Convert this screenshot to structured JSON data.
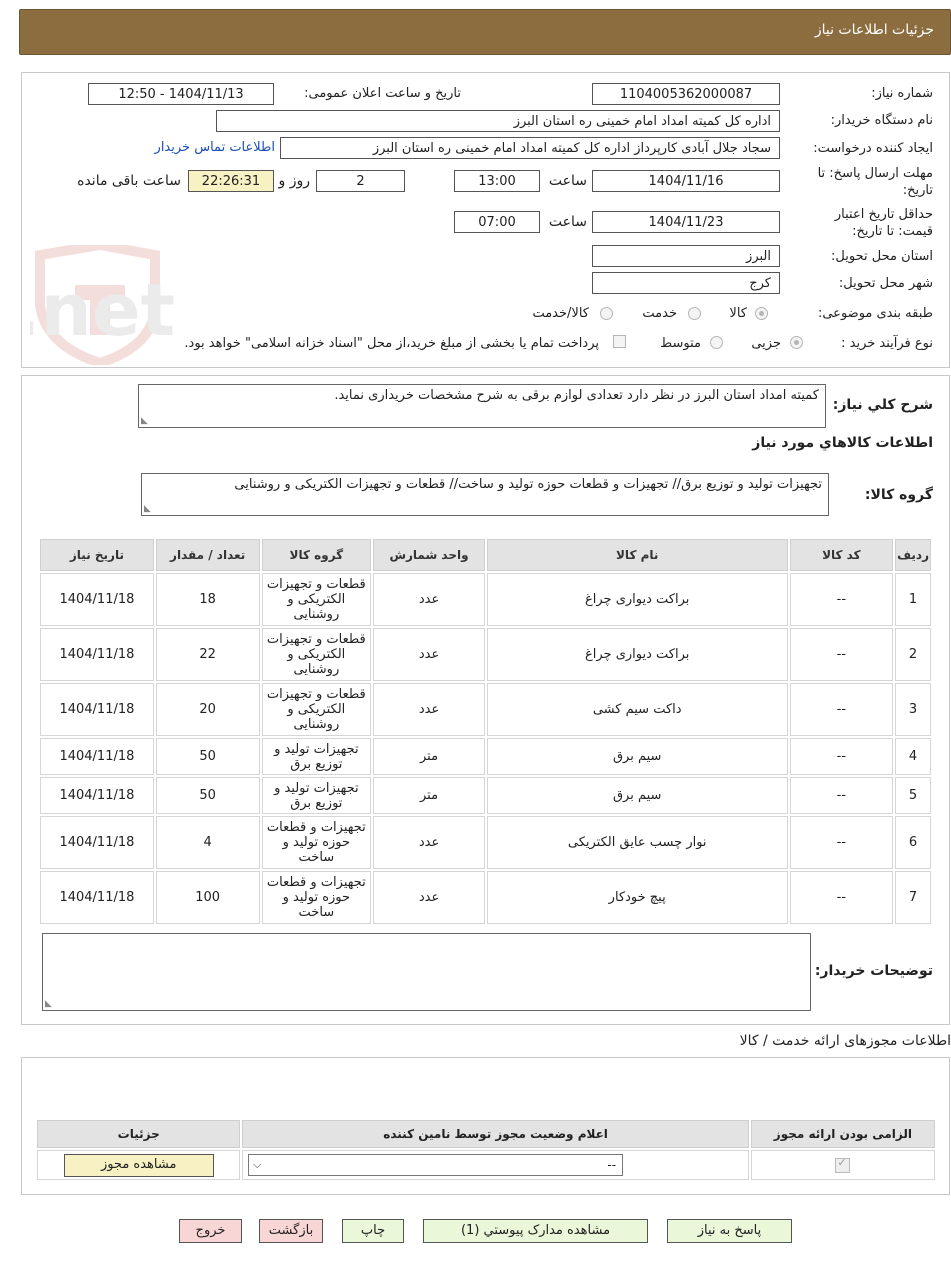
{
  "header": {
    "title": "جزئیات اطلاعات نیاز"
  },
  "info": {
    "need_number_label": "شماره نیاز:",
    "need_number": "1104005362000087",
    "announce_label": "تاریخ و ساعت اعلان عمومی:",
    "announce_value": "1404/11/13 - 12:50",
    "buyer_org_label": "نام دستگاه خریدار:",
    "buyer_org": "اداره کل کمیته امداد امام خمینی  ره  استان البرز",
    "requester_label": "ایجاد کننده درخواست:",
    "requester": "سجاد جلال آبادی کارپرداز اداره کل کمیته امداد امام خمینی  ره  استان البرز",
    "contact_link": "اطلاعات تماس خریدار",
    "deadline_label_1": "مهلت ارسال پاسخ: تا",
    "deadline_label_2": "تاریخ:",
    "deadline_date": "1404/11/16",
    "time_label": "ساعت",
    "deadline_time": "13:00",
    "days_value": "2",
    "days_label": "روز و",
    "remaining_time": "22:26:31",
    "remaining_label": "ساعت باقی مانده",
    "validity_label_1": "حداقل تاریخ اعتبار",
    "validity_label_2": "قیمت: تا تاریخ:",
    "validity_date": "1404/11/23",
    "validity_time": "07:00",
    "province_label": "استان محل تحویل:",
    "province": "البرز",
    "city_label": "شهر محل تحویل:",
    "city": "کرج",
    "category_label": "طبقه بندی موضوعی:",
    "category_options": [
      "کالا",
      "خدمت",
      "کالا/خدمت"
    ],
    "process_label": "نوع فرآیند خرید :",
    "process_options": [
      "جزیی",
      "متوسط"
    ],
    "process_note": "پرداخت تمام یا بخشی از مبلغ خرید،از محل \"اسناد خزانه اسلامی\" خواهد بود."
  },
  "watermark": "AriaTender.net",
  "description": {
    "label": "شرح کلي نياز:",
    "text": "کمیته امداد استان البرز در نظر دارد تعدادی لوازم برقی به شرح مشخصات خریداری نماید.",
    "goods_info_title": "اطلاعات کالاهاي مورد نياز",
    "goods_group_label": "گروه کالا:",
    "goods_group": "تجهیزات تولید و توزیع برق// تجهیزات و قطعات حوزه تولید و ساخت// قطعات و تجهیزات الکتریکی و روشنایی"
  },
  "items_table": {
    "headers": [
      "رديف",
      "کد کالا",
      "نام کالا",
      "واحد شمارش",
      "گروه کالا",
      "تعداد / مقدار",
      "تاریخ نیاز"
    ],
    "rows": [
      {
        "n": "1",
        "code": "--",
        "name": "براکت دیواری چراغ",
        "unit": "عدد",
        "group": "قطعات و تجهیزات الکتریکی و روشنایی",
        "qty": "18",
        "date": "1404/11/18"
      },
      {
        "n": "2",
        "code": "--",
        "name": "براکت دیواری چراغ",
        "unit": "عدد",
        "group": "قطعات و تجهیزات الکتریکی و روشنایی",
        "qty": "22",
        "date": "1404/11/18"
      },
      {
        "n": "3",
        "code": "--",
        "name": "داکت سیم کشی",
        "unit": "عدد",
        "group": "قطعات و تجهیزات الکتریکی و روشنایی",
        "qty": "20",
        "date": "1404/11/18"
      },
      {
        "n": "4",
        "code": "--",
        "name": "سیم برق",
        "unit": "متر",
        "group": "تجهیزات تولید و توزیع برق",
        "qty": "50",
        "date": "1404/11/18"
      },
      {
        "n": "5",
        "code": "--",
        "name": "سیم برق",
        "unit": "متر",
        "group": "تجهیزات تولید و توزیع برق",
        "qty": "50",
        "date": "1404/11/18"
      },
      {
        "n": "6",
        "code": "--",
        "name": "نوار چسب عایق الکتریکی",
        "unit": "عدد",
        "group": "تجهیزات و قطعات حوزه تولید و ساخت",
        "qty": "4",
        "date": "1404/11/18"
      },
      {
        "n": "7",
        "code": "--",
        "name": "پیچ خودکار",
        "unit": "عدد",
        "group": "تجهیزات و قطعات حوزه تولید و ساخت",
        "qty": "100",
        "date": "1404/11/18"
      }
    ]
  },
  "buyer_notes": {
    "label": "توضیحات خریدار:",
    "text": ""
  },
  "licenses": {
    "title": "اطلاعات مجوزهای ارائه خدمت / کالا",
    "headers": [
      "الزامی بودن ارائه مجوز",
      "اعلام وضعیت مجوز توسط نامین کننده",
      "جزئیات"
    ],
    "select_value": "--",
    "view_button": "مشاهده مجوز"
  },
  "buttons": {
    "reply": "پاسخ به نیاز",
    "attachments": "مشاهده مدارک پیوستي (1)",
    "print": "چاپ",
    "back": "بازگشت",
    "exit": "خروج"
  }
}
